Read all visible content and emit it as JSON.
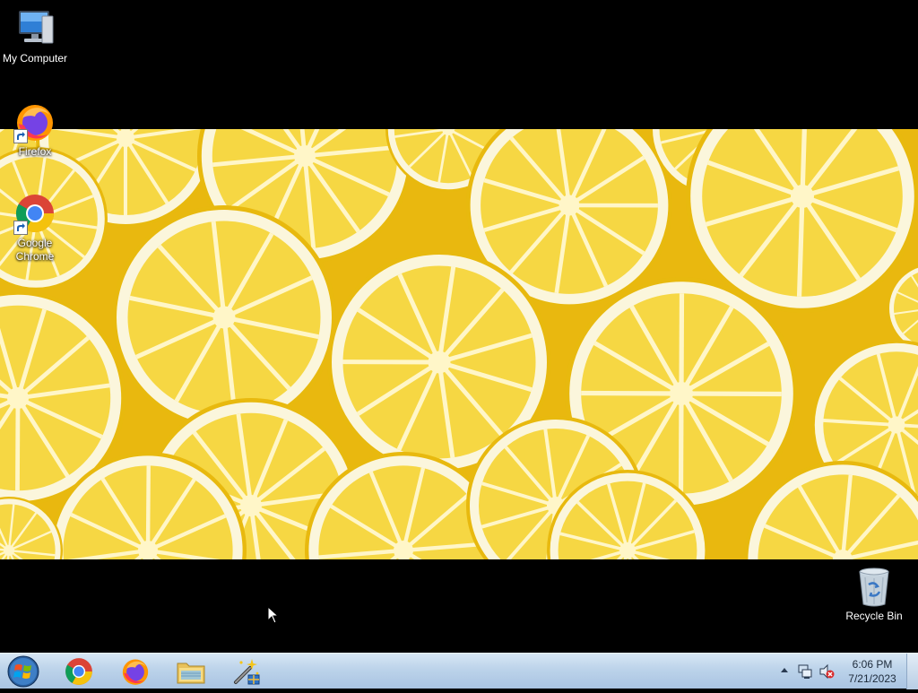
{
  "desktop": {
    "icons": [
      {
        "label": "My Computer"
      },
      {
        "label": "Firefox"
      },
      {
        "label": "Google Chrome"
      },
      {
        "label": "Recycle Bin"
      }
    ]
  },
  "wallpaper": {
    "subject": "lemon-slices-wallpaper"
  },
  "taskbar": {
    "pinned": [
      {
        "icon": "chrome-icon"
      },
      {
        "icon": "firefox-icon"
      },
      {
        "icon": "file-explorer-icon"
      },
      {
        "icon": "setup-wizard-icon"
      }
    ],
    "tray": {
      "icons": [
        "show-hidden-icons-arrow",
        "network-icon",
        "volume-muted-icon"
      ]
    },
    "clock": {
      "time": "6:06 PM",
      "date": "7/21/2023"
    }
  },
  "colors": {
    "taskbar": "#bcd3ea",
    "lemon": "#f6d743",
    "rind": "#fbf6dc"
  }
}
